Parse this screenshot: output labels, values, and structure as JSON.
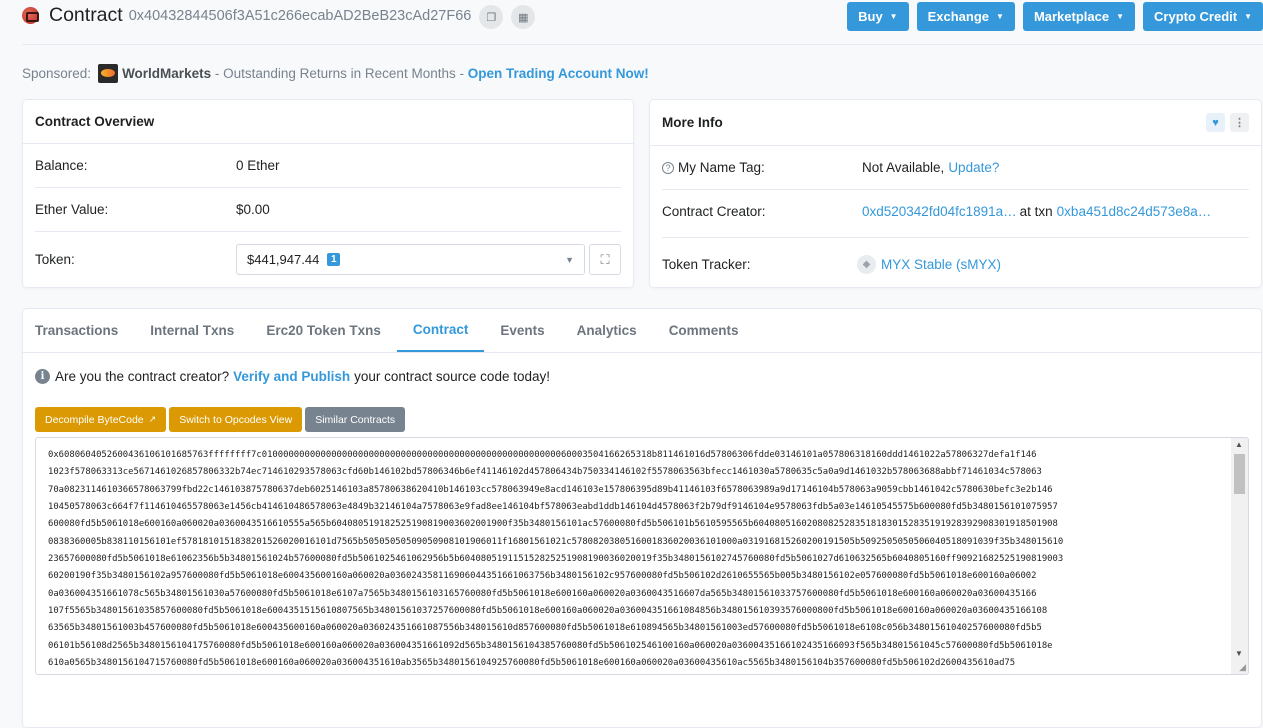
{
  "header": {
    "title": "Contract",
    "address": "0x40432844506f3A51c266ecabAD2BeB23cAd27F66",
    "actions": [
      "Buy",
      "Exchange",
      "Marketplace",
      "Crypto Credit"
    ]
  },
  "sponsored": {
    "label": "Sponsored:",
    "brand": "WorldMarkets",
    "text": " - Outstanding Returns in Recent Months - ",
    "cta": "Open Trading Account Now!"
  },
  "overview": {
    "title": "Contract Overview",
    "balance_label": "Balance:",
    "balance_value": "0 Ether",
    "ether_value_label": "Ether Value:",
    "ether_value": "$0.00",
    "token_label": "Token:",
    "token_value": "$441,947.44",
    "token_count": "1"
  },
  "more_info": {
    "title": "More Info",
    "name_tag_label": "My Name Tag:",
    "name_tag_value": "Not Available,",
    "name_tag_update": "Update?",
    "creator_label": "Contract Creator:",
    "creator_address": "0xd520342fd04fc1891a…",
    "creator_at_txn": "at txn",
    "creator_txn": "0xba451d8c24d573e8a…",
    "tracker_label": "Token Tracker:",
    "tracker_value": "MYX Stable (sMYX)"
  },
  "tabs": [
    "Transactions",
    "Internal Txns",
    "Erc20 Token Txns",
    "Contract",
    "Events",
    "Analytics",
    "Comments"
  ],
  "active_tab": "Contract",
  "contract": {
    "info_prefix": "Are you the contract creator?",
    "info_link": "Verify and Publish",
    "info_suffix": "your contract source code today!",
    "decompile_label": "Decompile ByteCode",
    "opcodes_label": "Switch to Opcodes View",
    "similar_label": "Similar Contracts",
    "bytecode_lines": [
      "0x6080604052600436106101685763ffffffff7c0100000000000000000000000000000000000000000000000000000060003504166265318b811461016d57806306fdde03146101a057806318160ddd1461022a57806327defa1f146",
      "1023f578063313ce5671461026857806332b74ec714610293578063cfd60b146102bd57806346b6ef41146102d457806434b750334146102f5578063563bfecc1461030a5780635c5a0a9d1461032b578063688abbf71461034c578063",
      "70a0823114610366578063799fbd22c146103875780637deb6025146103a85780638620410b146103cc578063949e8acd146103e157806395d89b41146103f6578063989a9d17146104b578063a9059cbb1461042c5780630befc3e2b146",
      "10450578063c664f7f114610465578063e1456cb414610486578063e4849b32146104a7578063e9fad8ee146104bf578063eabd1ddb146104d4578063f2b79df9146104e9578063fdb5a03e14610545575b600080fd5b3480156101075957",
      "600080fd5b5061018e600160a060020a0360043516610555a565b604080519182525190819003602001900f35b3480156101ac57600080fd5b506101b5610595565b604080516020808252835181830152835191928392908301918501908",
      "0838360005b838110156101ef5781810151838201526020016101d7565b50505050509050908101906011f16801561021c5780820380516001836020036101000a031916815260200191505b5092505050506040518091039f35b348015610",
      "23657600080fd5b5061018e61062356b5b34801561024b57600080fd5b5061025461062956b5b604080519115152825251908190036020019f35b3480156102745760080fd5b5061027d610632565b6040805160ff90921682525190819003",
      "60200190f35b3480156102a957600080fd5b5061018e600435600160a060020a036024358116906044351661063756b3480156102c957600080fd5b506102d2610655565b005b3480156102e057600080fd5b5061018e600160a06002",
      "0a036004351661078c565b34801561030a57600080fd5b5061018e6107a7565b3480156103165760080fd5b5061018e600160a060020a0360043516607da565b34801561033757600080fd5b5061018e600160a060020a03600435166",
      "107f5565b34801561035857600080fd5b5061018e6004351515610807565b34801561037257600080fd5b5061018e600160a060020a036004351661084856b348015610393576000800fd5b5061018e600160a060020a03600435166108",
      "63565b34801561003b457600080fd5b5061018e600435600160a060020a036024351661087556b348015610d857600080fd5b5061018e610894565b34801561003ed57600080fd5b5061018e6108c056b34801561040257600080fd5b5",
      "06101b56108d2565b3480156104175760080fd5b5061018e600160a060020a036004351661092d565b3480156104385760080fd5b506102546100160a060020a03600435166102435166093f565b34801561045c57600080fd5b5061018e",
      "610a0565b3480156104715760080fd5b5061018e600160a060020a036004351610ab3565b3480156104925760080fd5b5061018e600160a060020a03600435610ac5565b3480156104b357600080fd5b506102d2600435610ad75",
      "fb3480156104c857600080fd5b506102d2610ae1565b3480156104dd57600080fd5b506102d2610b11565b3480156104f257600080fd5b5061018e600160a060020a0360043516610b40565b34801561051357600080fd5b50"
    ]
  },
  "colors": {
    "accent": "#3498db",
    "orange": "#db9a04",
    "gray": "#77838f"
  }
}
